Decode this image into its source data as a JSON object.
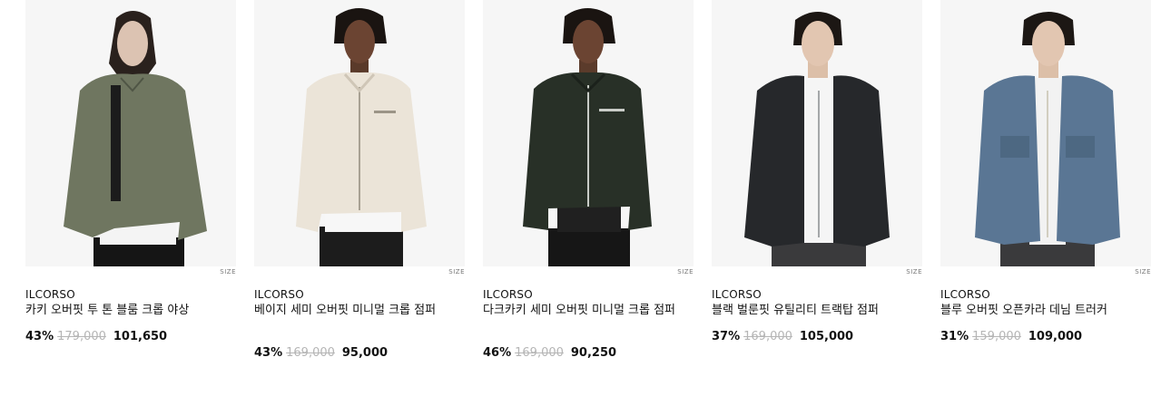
{
  "products": [
    {
      "brand": "ILCORSO",
      "name": "카키 오버핏 투 톤 블룸 크롭 야상",
      "discount": "43%",
      "original_price": "179,000",
      "sale_price": "101,650",
      "size_label": "SIZE",
      "jacket_color": "#6f7660"
    },
    {
      "brand": "ILCORSO",
      "name": "베이지 세미 오버핏 미니멀 크롭 점퍼",
      "discount": "43%",
      "original_price": "169,000",
      "sale_price": "95,000",
      "size_label": "SIZE",
      "jacket_color": "#ebe4d8"
    },
    {
      "brand": "ILCORSO",
      "name": "다크카키 세미 오버핏 미니멀 크롭 점퍼",
      "discount": "46%",
      "original_price": "169,000",
      "sale_price": "90,250",
      "size_label": "SIZE",
      "jacket_color": "#283027"
    },
    {
      "brand": "ILCORSO",
      "name": "블랙 벌룬핏 유틸리티 트랙탑 점퍼",
      "discount": "37%",
      "original_price": "169,000",
      "sale_price": "105,000",
      "size_label": "SIZE",
      "jacket_color": "#26282b"
    },
    {
      "brand": "ILCORSO",
      "name": "블루 오버핏 오픈카라 데님 트러커",
      "discount": "31%",
      "original_price": "159,000",
      "sale_price": "109,000",
      "size_label": "SIZE",
      "jacket_color": "#5a7694"
    }
  ]
}
